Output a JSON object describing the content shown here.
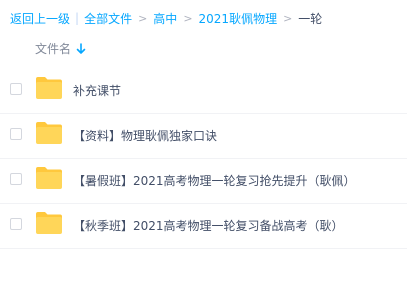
{
  "breadcrumb": {
    "back": "返回上一级",
    "all_files": "全部文件",
    "level1": "高中",
    "level2": "2021耿佩物理",
    "current": "一轮"
  },
  "header": {
    "file_name": "文件名"
  },
  "files": [
    {
      "name": "补充课节"
    },
    {
      "name": "【资料】物理耿佩独家口诀"
    },
    {
      "name": "【暑假班】2021高考物理一轮复习抢先提升（耿佩）"
    },
    {
      "name": "【秋季班】2021高考物理一轮复习备战高考（耿）"
    }
  ],
  "colors": {
    "link": "#06a7ff",
    "folder": "#ffd659",
    "folder_tab": "#ffc83d",
    "text": "#424e67"
  }
}
